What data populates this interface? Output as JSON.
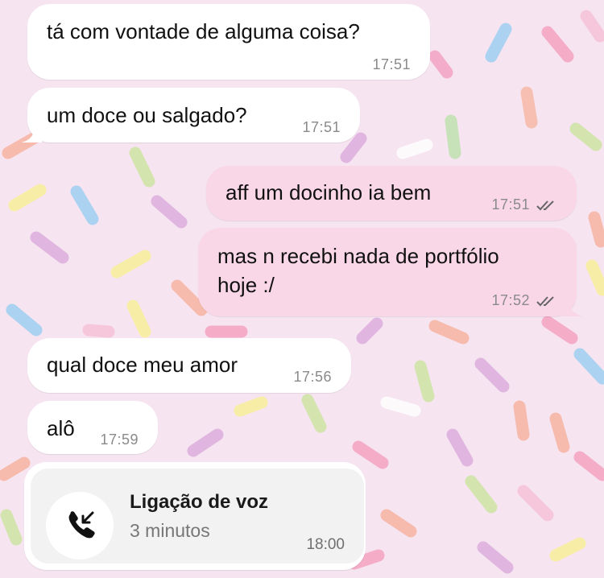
{
  "chat": {
    "messages": [
      {
        "direction": "in",
        "text": "tá com vontade de alguma coisa?",
        "time": "17:51"
      },
      {
        "direction": "in",
        "text": "um doce ou salgado?",
        "time": "17:51"
      },
      {
        "direction": "out",
        "text": "aff um docinho ia bem",
        "time": "17:51",
        "status": "read"
      },
      {
        "direction": "out",
        "text_lines": [
          "mas n recebi nada de portfólio",
          "hoje :/"
        ],
        "time": "17:52",
        "status": "read"
      },
      {
        "direction": "in",
        "text": "qual doce meu amor",
        "time": "17:56"
      },
      {
        "direction": "in",
        "text": "alô",
        "time": "17:59"
      }
    ],
    "call": {
      "title": "Ligação de voz",
      "duration": "3 minutos",
      "time": "18:00",
      "icon": "incoming-call-icon"
    }
  },
  "colors": {
    "wallpaper": "#f6e4f1",
    "incoming_bubble": "#ffffff",
    "outgoing_bubble": "#f9d7e6",
    "call_card": "#f2f2f2"
  }
}
